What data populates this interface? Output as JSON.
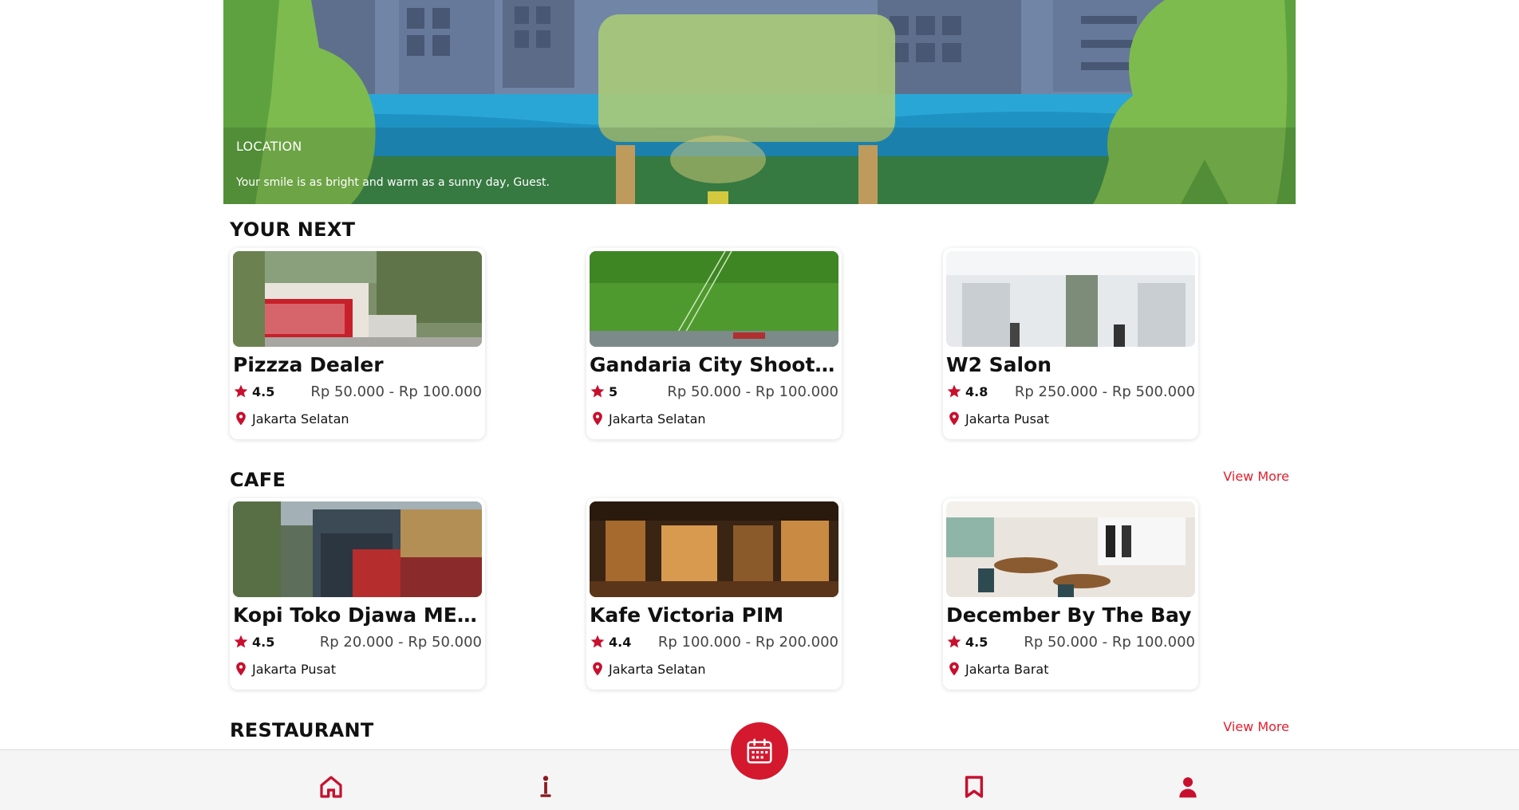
{
  "hero": {
    "location_label": "LOCATION",
    "greeting": "Your smile is as bright and warm as a sunny day, Guest."
  },
  "sections": [
    {
      "title": "YOUR NEXT",
      "view_more": "",
      "items": [
        {
          "name": "Pizzza Dealer",
          "rating": "4.5",
          "price": "Rp 50.000 - Rp 100.000",
          "location": "Jakarta Selatan"
        },
        {
          "name": "Gandaria City Shooting ...",
          "rating": "5",
          "price": "Rp 50.000 - Rp 100.000",
          "location": "Jakarta Selatan"
        },
        {
          "name": "W2 Salon",
          "rating": "4.8",
          "price": "Rp 250.000 - Rp 500.000",
          "location": "Jakarta Pusat"
        }
      ]
    },
    {
      "title": "CAFE",
      "view_more": "View More",
      "items": [
        {
          "name": "Kopi Toko Djawa MENTE...",
          "rating": "4.5",
          "price": "Rp 20.000 - Rp 50.000",
          "location": "Jakarta Pusat"
        },
        {
          "name": "Kafe Victoria PIM",
          "rating": "4.4",
          "price": "Rp 100.000 - Rp 200.000",
          "location": "Jakarta Selatan"
        },
        {
          "name": "December By The Bay",
          "rating": "4.5",
          "price": "Rp 50.000 - Rp 100.000",
          "location": "Jakarta Barat"
        }
      ]
    },
    {
      "title": "RESTAURANT",
      "view_more": "View More",
      "items": []
    }
  ],
  "nav": {
    "items": [
      "home-icon",
      "info-icon",
      "calendar-icon",
      "bookmark-icon",
      "profile-icon"
    ]
  },
  "colors": {
    "accent": "#d4192f",
    "link": "#e0202e"
  }
}
